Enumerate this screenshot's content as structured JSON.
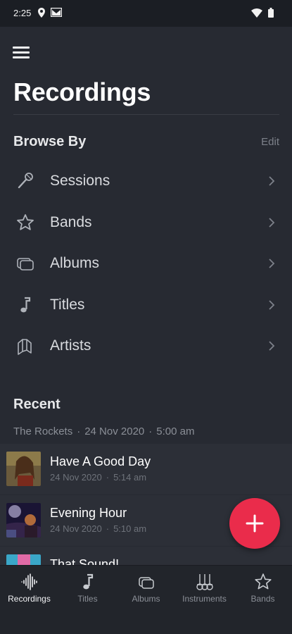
{
  "status_bar": {
    "time": "2:25",
    "left_icons": [
      "location-icon",
      "gmail-icon"
    ],
    "right_icons": [
      "wifi-icon",
      "battery-icon"
    ]
  },
  "header": {
    "title": "Recordings",
    "menu_icon": "hamburger-menu-icon"
  },
  "browse": {
    "heading": "Browse By",
    "edit_label": "Edit",
    "items": [
      {
        "label": "Sessions",
        "icon": "microphone-icon"
      },
      {
        "label": "Bands",
        "icon": "star-icon"
      },
      {
        "label": "Albums",
        "icon": "albums-icon"
      },
      {
        "label": "Titles",
        "icon": "music-note-icon"
      },
      {
        "label": "Artists",
        "icon": "artists-icon"
      }
    ]
  },
  "recent": {
    "heading": "Recent",
    "session": {
      "band": "The Rockets",
      "date": "24 Nov 2020",
      "time": "5:00 am"
    },
    "recordings": [
      {
        "title": "Have A Good Day",
        "date": "24 Nov 2020",
        "time": "5:14 am"
      },
      {
        "title": "Evening Hour",
        "date": "24 Nov 2020",
        "time": "5:10 am"
      },
      {
        "title": "That Sound!",
        "date": "",
        "time": ""
      }
    ]
  },
  "fab": {
    "icon": "plus-icon",
    "color": "#ea2c4b"
  },
  "tab_bar": {
    "tabs": [
      {
        "label": "Recordings",
        "icon": "waveform-icon",
        "active": true
      },
      {
        "label": "Titles",
        "icon": "music-note-icon",
        "active": false
      },
      {
        "label": "Albums",
        "icon": "albums-icon",
        "active": false
      },
      {
        "label": "Instruments",
        "icon": "guitars-icon",
        "active": false
      },
      {
        "label": "Bands",
        "icon": "star-icon",
        "active": false
      }
    ]
  },
  "colors": {
    "background": "#272a32",
    "accent": "#ea2c4b",
    "text_primary": "#ffffff",
    "text_secondary": "#8b8f97"
  }
}
